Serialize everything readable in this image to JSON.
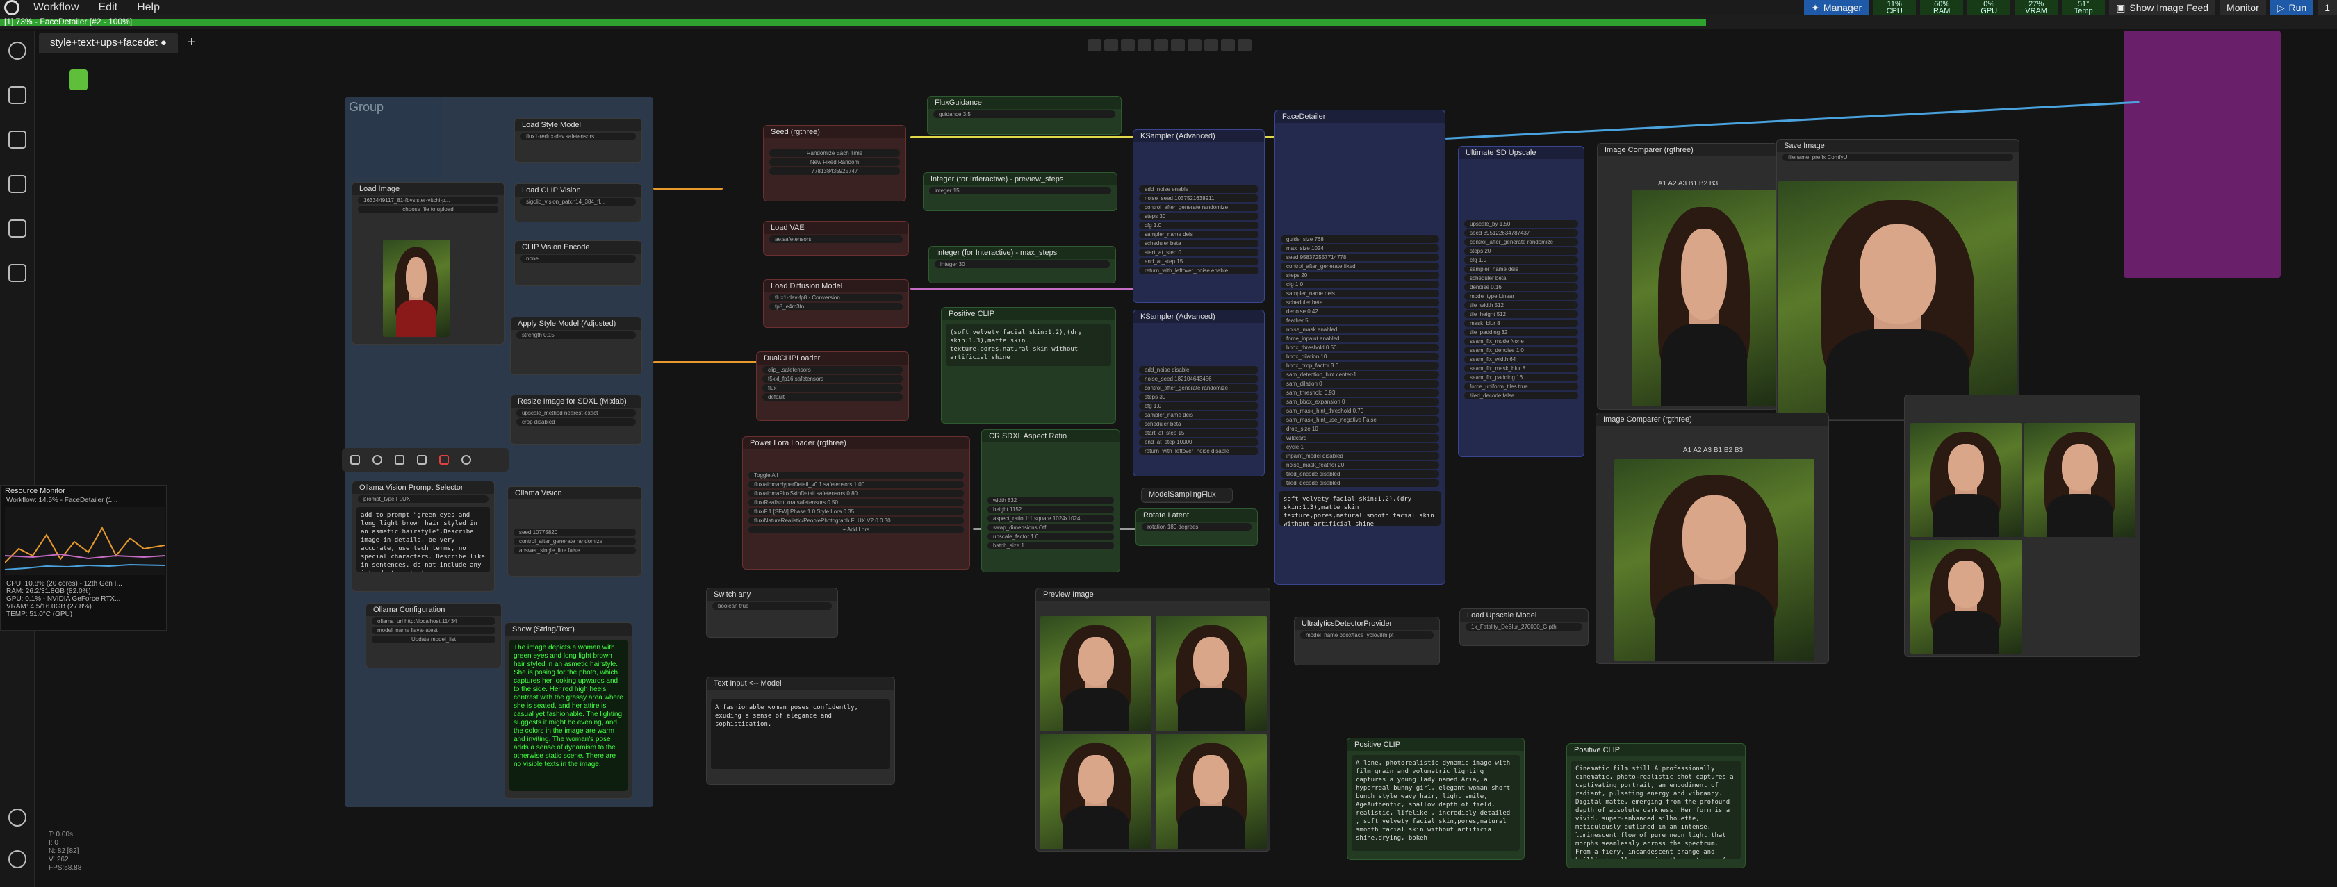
{
  "menu": [
    "Workflow",
    "Edit",
    "Help"
  ],
  "progress": {
    "text": "[1] 73% - FaceDetailer [#2 - 100%]",
    "fraction": 0.73
  },
  "tab": {
    "label": "style+text+ups+facedet",
    "dot": "●",
    "add": "+"
  },
  "tools": {
    "manager": "Manager",
    "stats": [
      {
        "label": "CPU",
        "value": "11%"
      },
      {
        "label": "RAM",
        "value": "60%"
      },
      {
        "label": "GPU",
        "value": "0%"
      },
      {
        "label": "VRAM",
        "value": "27%"
      },
      {
        "label": "Temp",
        "value": "51°"
      }
    ],
    "show_feed": "Show Image Feed",
    "monitor": "Monitor",
    "run": "Run",
    "run_count": "1"
  },
  "group_title": "Group",
  "nodes": {
    "load_style_model": {
      "title": "Load Style Model",
      "id": "#120",
      "rows": [
        "flux1-redux-dev.safetensors"
      ]
    },
    "load_image": {
      "title": "Load Image",
      "id": "#117",
      "rows": [
        "1633449117_81-fbvsister-vitchi-p...",
        "choose file to upload"
      ]
    },
    "load_clip_vision": {
      "title": "Load CLIP Vision",
      "id": "#119",
      "rows": [
        "sigclip_vision_patch14_384_fl..."
      ]
    },
    "clip_vision_encode": {
      "title": "CLIP Vision Encode",
      "id": "#118",
      "rows": [
        "none"
      ]
    },
    "apply_style": {
      "title": "Apply Style Model (Adjusted)",
      "id": "#126",
      "rows": [
        "strength 0.15"
      ]
    },
    "resize": {
      "title": "Resize Image for SDXL (Mixlab)",
      "id": "#122",
      "rows": [
        "upscale_method nearest-exact",
        "crop disabled"
      ]
    },
    "seed": {
      "title": "Seed (rgthree)",
      "id": "#79",
      "rows": [
        "Randomize Each Time",
        "New Fixed Random",
        "778138435925747"
      ]
    },
    "flux_guidance": {
      "title": "FluxGuidance",
      "id": "#40",
      "rows": [
        "guidance 3.5"
      ]
    },
    "preview_steps": {
      "title": "Integer (for Interactive) - preview_steps",
      "id": "#31",
      "rows": [
        "integer 15"
      ]
    },
    "max_steps": {
      "title": "Integer (for Interactive) - max_steps",
      "id": "#5",
      "rows": [
        "integer 30"
      ]
    },
    "load_vae": {
      "title": "Load VAE",
      "id": "#12",
      "rows": [
        "ae.safetensors"
      ]
    },
    "load_diffusion": {
      "title": "Load Diffusion Model",
      "id": "#10",
      "rows": [
        "flux1-dev-fp8 - Conversion...",
        "fp8_e4m3fn"
      ]
    },
    "dual_clip": {
      "title": "DualCLIPLoader",
      "id": "#11",
      "rows": [
        "clip_l.safetensors",
        "t5xxl_fp16.safetensors",
        "flux",
        "default"
      ]
    },
    "positive_clip_main": {
      "title": "Positive CLIP",
      "id": "#44",
      "text": "(soft velvety facial skin:1.2),(dry skin:1.3),matte skin texture,pores,natural skin without artificial shine"
    },
    "ksampler1": {
      "title": "KSampler (Advanced)",
      "id": "#1",
      "rows": [
        "add_noise enable",
        "noise_seed 1037521638911",
        "control_after_generate randomize",
        "steps 30",
        "cfg 1.0",
        "sampler_name deis",
        "scheduler beta",
        "start_at_step 0",
        "end_at_step 15",
        "return_with_leftover_noise enable"
      ]
    },
    "ksampler2": {
      "title": "KSampler (Advanced)",
      "id": "#2",
      "rows": [
        "add_noise disable",
        "noise_seed 182104643456",
        "control_after_generate randomize",
        "steps 30",
        "cfg 1.0",
        "sampler_name deis",
        "scheduler beta",
        "start_at_step 15",
        "end_at_step 10000",
        "return_with_leftover_noise disable"
      ]
    },
    "facedetailer": {
      "title": "FaceDetailer",
      "id": "#80",
      "rows": [
        "guide_size 768",
        "max_size 1024",
        "seed 958372557714778",
        "control_after_generate fixed",
        "steps 20",
        "cfg 1.0",
        "sampler_name deis",
        "scheduler beta",
        "denoise 0.42",
        "feather 5",
        "noise_mask enabled",
        "force_inpaint enabled",
        "bbox_threshold 0.50",
        "bbox_dilation 10",
        "bbox_crop_factor 3.0",
        "sam_detection_hint center-1",
        "sam_dilation 0",
        "sam_threshold 0.93",
        "sam_bbox_expansion 0",
        "sam_mask_hint_threshold 0.70",
        "sam_mask_hint_use_negative False",
        "drop_size 10",
        "wildcard",
        "cycle 1",
        "inpaint_model disabled",
        "noise_mask_feather 20",
        "tiled_encode disabled",
        "tiled_decode disabled"
      ]
    },
    "facedetailer_text": "soft velvety facial skin:1.2),(dry skin:1.3),matte skin texture,pores,natural smooth facial skin without artificial shine",
    "ultimate_sd": {
      "title": "Ultimate SD Upscale",
      "id": "#4",
      "rows": [
        "upscale_by 1.50",
        "seed 395122634787437",
        "control_after_generate randomize",
        "steps 20",
        "cfg 1.0",
        "sampler_name deis",
        "scheduler beta",
        "denoise 0.16",
        "mode_type Linear",
        "tile_width 512",
        "tile_height 512",
        "mask_blur 8",
        "tile_padding 32",
        "seam_fix_mode None",
        "seam_fix_denoise 1.0",
        "seam_fix_width 64",
        "seam_fix_mask_blur 8",
        "seam_fix_padding 16",
        "force_uniform_tiles true",
        "tiled_decode false"
      ]
    },
    "image_comparer1": {
      "title": "Image Comparer (rgthree)",
      "id": "#14",
      "labels": "A1 A2 A3 B1 B2 B3"
    },
    "save_image": {
      "title": "Save Image",
      "id": "#9",
      "rows": [
        "filename_prefix ComfyUI"
      ]
    },
    "image_comparer2": {
      "title": "Image Comparer (rgthree)",
      "id": "#15",
      "labels": "A1 A2 A3 B1 B2 B3"
    },
    "ollama_selector": {
      "title": "Ollama Vision Prompt Selector",
      "id": "#135",
      "rows": [
        "prompt_type FLUX"
      ],
      "text": "add to prompt \"green eyes and long light brown hair styled in an asmetic hairstyle\".Describe image in details, be very accurate, use tech terms, no special characters. Describe like in sentences. do not include any introductory text or explanations, make it a clean one liner answer."
    },
    "ollama_vision": {
      "title": "Ollama Vision",
      "id": "#136",
      "rows": [
        "query_type",
        "seed 10775820",
        "control_after_generate randomize",
        "answer_single_line false"
      ]
    },
    "ollama_config": {
      "title": "Ollama Configuration",
      "id": "#137",
      "rows": [
        "ollama_url http://localhost:11434",
        "model_name llava-latest",
        "Update model_list"
      ]
    },
    "show_string": {
      "title": "Show (String/Text)",
      "id": "#139",
      "text": "The image depicts a woman with green eyes and long light brown hair styled in an asmetic hairstyle. She is posing for the photo, which captures her looking upwards and to the side. Her red high heels contrast with the grassy area where she is seated, and her attire is casual yet fashionable. The lighting suggests it might be evening, and the colors in the image are warm and inviting. The woman's pose adds a sense of dynamism to the otherwise static scene. There are no visible texts in the image."
    },
    "power_lora": {
      "title": "Power Lora Loader (rgthree)",
      "id": "#87",
      "rows": [
        "Toggle All",
        "flux/aidmaHyperDetail_v0.1.safetensors 1.00",
        "flux/aidmaFluxSkinDetail.safetensors 0.80",
        "flux/RealismLora.safetensors 0.50",
        "flux/F.1 [SFW] Phase 1.0 Style Lora 0.35",
        "flux/NatureRealistic/PeoplePhotograph.FLUX.V2.0 0.30",
        "+ Add Lora"
      ]
    },
    "cr_sdxl": {
      "title": "CR SDXL Aspect Ratio",
      "id": "#20",
      "rows": [
        "width 832",
        "height 1152",
        "aspect_ratio 1:1 square 1024x1024",
        "swap_dimensions Off",
        "upscale_factor 1.0",
        "batch_size 1"
      ]
    },
    "model_sampling": {
      "title": "ModelSamplingFlux",
      "id": "#47"
    },
    "rotate_latent": {
      "title": "Rotate Latent",
      "id": "#132",
      "rows": [
        "rotation 180 degrees"
      ]
    },
    "switch_any": {
      "title": "Switch any",
      "id": "#141",
      "rows": [
        "boolean true"
      ]
    },
    "text_input": {
      "title": "Text Input <-- Model",
      "id": "#142",
      "text": "A fashionable woman poses confidently, exuding a sense of elegance and sophistication."
    },
    "preview_image": {
      "title": "Preview Image",
      "id": "#17"
    },
    "ultralytics": {
      "title": "UltralyticsDetectorProvider",
      "id": "#83",
      "rows": [
        "model_name bbox/face_yolov8m.pt"
      ]
    },
    "load_upscale": {
      "title": "Load Upscale Model",
      "id": "#7",
      "rows": [
        "1x_Fatality_DeBlur_270000_G.pth"
      ]
    },
    "positive_clip_2": {
      "title": "Positive CLIP",
      "id": "#134",
      "text": "A lone, photorealistic dynamic image with film grain and volumetric lighting captures a young lady named Aria, a hyperreal bunny girl, elegant woman short bunch style wavy hair, light smile, AgeAuthentic, shallow depth of field, realistic, lifelike , incredibly detailed , soft velvety facial skin,pores,natural smooth facial skin without artificial shine,drying, bokeh"
    },
    "positive_clip_3": {
      "title": "Positive CLIP",
      "id": "#133",
      "text": "Cinematic film still A professionally cinematic, photo-realistic shot captures a captivating portrait, an embodiment of radiant, pulsating energy and vibrancy. Digital matte, emerging from the profound depth of absolute darkness. Her form is a vivid, super-enhanced silhouette, meticulously outlined in an intense, luminescent flow of pure neon light that morphs seamlessly across the spectrum. From a fiery, incandescent orange and brilliant yellow tracing the contours of her flowing hair and shoulders. Transitioning into electric cyan, deep azure, and captivating purple, fluidly dissolving into a cool, ethereal blue along her hairline and lips. Within this luminous shell, her features are rendered with a sharp, almost graphic clarity, her eyes glowing with an internal, ember luminescence that pierces."
    }
  },
  "resource_monitor": {
    "title": "Resource Monitor",
    "lines": [
      "Workflow: 14.5% - FaceDetailer (1...",
      "CPU: 10.8% (20 cores) - 12th Gen I...",
      "RAM: 26.2/31.8GB (82.0%)",
      "GPU: 0.1% - NVIDIA GeForce RTX...",
      "VRAM: 4.5/16.0GB (27.8%)",
      "TEMP: 51.0°C (GPU)"
    ]
  },
  "stats_overlay": [
    "T: 0.00s",
    "I: 0",
    "N: 82 [82]",
    "V: 262",
    "FPS:58.88"
  ],
  "colors": {
    "accent": "#1e5aa8",
    "progress": "#2fa12f",
    "group_bg": "#2f3f55",
    "purple_group": "#6a1f6a"
  }
}
